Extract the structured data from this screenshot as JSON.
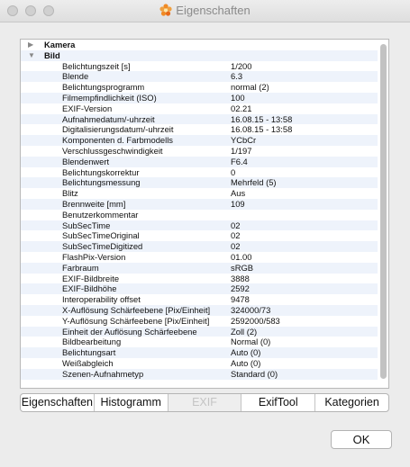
{
  "window": {
    "title": "Eigenschaften",
    "app_icon": "tangerine-flower-icon"
  },
  "groups": [
    {
      "label": "Kamera",
      "expanded": false
    },
    {
      "label": "Bild",
      "expanded": true
    }
  ],
  "properties": [
    {
      "key": "Belichtungszeit [s]",
      "value": "1/200"
    },
    {
      "key": "Blende",
      "value": "6.3"
    },
    {
      "key": "Belichtungsprogramm",
      "value": "normal (2)"
    },
    {
      "key": "Filmempfindlichkeit (ISO)",
      "value": "100"
    },
    {
      "key": "EXIF-Version",
      "value": "02.21"
    },
    {
      "key": "Aufnahmedatum/-uhrzeit",
      "value": "16.08.15 - 13:58"
    },
    {
      "key": "Digitalisierungsdatum/-uhrzeit",
      "value": "16.08.15 - 13:58"
    },
    {
      "key": "Komponenten d. Farbmodells",
      "value": "YCbCr"
    },
    {
      "key": "Verschlussgeschwindigkeit",
      "value": "1/197"
    },
    {
      "key": "Blendenwert",
      "value": "F6.4"
    },
    {
      "key": "Belichtungskorrektur",
      "value": "0"
    },
    {
      "key": "Belichtungsmessung",
      "value": "Mehrfeld (5)"
    },
    {
      "key": "Blitz",
      "value": "Aus"
    },
    {
      "key": "Brennweite [mm]",
      "value": "109"
    },
    {
      "key": "Benutzerkommentar",
      "value": ""
    },
    {
      "key": "SubSecTime",
      "value": "02"
    },
    {
      "key": "SubSecTimeOriginal",
      "value": "02"
    },
    {
      "key": "SubSecTimeDigitized",
      "value": "02"
    },
    {
      "key": "FlashPix-Version",
      "value": "01.00"
    },
    {
      "key": "Farbraum",
      "value": "sRGB"
    },
    {
      "key": "EXIF-Bildbreite",
      "value": "3888"
    },
    {
      "key": "EXIF-Bildhöhe",
      "value": "2592"
    },
    {
      "key": "Interoperability offset",
      "value": "9478"
    },
    {
      "key": "X-Auflösung Schärfeebene [Pix/Einheit]",
      "value": "324000/73"
    },
    {
      "key": "Y-Auflösung Schärfeebene [Pix/Einheit]",
      "value": "2592000/583"
    },
    {
      "key": "Einheit der Auflösung Schärfeebene",
      "value": "Zoll (2)"
    },
    {
      "key": "Bildbearbeitung",
      "value": "Normal (0)"
    },
    {
      "key": "Belichtungsart",
      "value": "Auto (0)"
    },
    {
      "key": "Weißabgleich",
      "value": "Auto (0)"
    },
    {
      "key": "Szenen-Aufnahmetyp",
      "value": "Standard (0)"
    }
  ],
  "tabs": [
    {
      "label": "Eigenschaften",
      "active": false
    },
    {
      "label": "Histogramm",
      "active": false
    },
    {
      "label": "EXIF",
      "active": true
    },
    {
      "label": "ExifTool",
      "active": false
    },
    {
      "label": "Kategorien",
      "active": false
    }
  ],
  "ok_label": "OK",
  "colors": {
    "row_alt": "#eef3fb",
    "active_tab_text": "#c4c4c4"
  }
}
